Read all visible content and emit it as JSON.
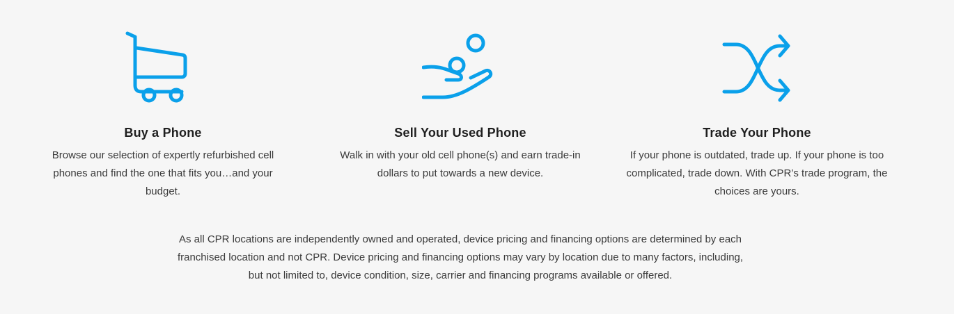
{
  "colors": {
    "accent": "#0aa0ea",
    "background": "#f6f6f6",
    "heading": "#1f1f1f",
    "body_text": "#3a3a3a"
  },
  "features": [
    {
      "icon": "shopping-cart-icon",
      "title": "Buy a Phone",
      "description": "Browse our selection of expertly refurbished cell phones and find the one that fits you…and your budget."
    },
    {
      "icon": "hand-with-coins-icon",
      "title": "Sell Your Used Phone",
      "description": "Walk in with your old cell phone(s) and earn trade-in dollars to put towards a new device."
    },
    {
      "icon": "shuffle-arrows-icon",
      "title": "Trade Your Phone",
      "description": "If your phone is outdated, trade up. If your phone is too complicated, trade down. With CPR’s trade program, the choices are yours."
    }
  ],
  "disclaimer": "As all CPR locations are independently owned and operated, device pricing and financing options are determined by each franchised location and not CPR. Device pricing and financing options may vary by location due to many factors, including, but not limited to, device condition, size, carrier and financing programs available or offered."
}
